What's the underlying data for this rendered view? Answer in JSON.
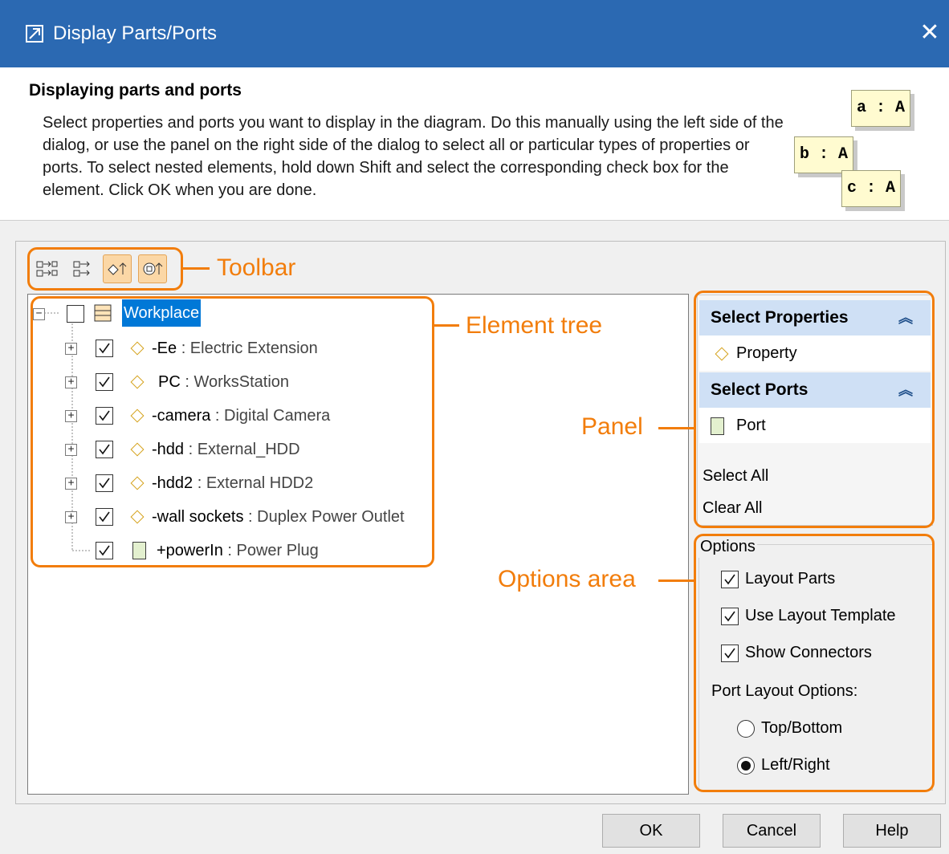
{
  "window": {
    "title": "Display Parts/Ports",
    "close_icon": "close-icon"
  },
  "header": {
    "title": "Displaying parts and ports",
    "description": "Select properties and ports you want to display in the diagram. Do this manually using the left side of the dialog, or use the panel on the right side of the dialog to select all or particular types of properties or ports. To select nested elements, hold down Shift and select the corresponding check box for the element. Click OK when you are done.",
    "classifiers": [
      "a : A",
      "b : A",
      "c : A"
    ]
  },
  "toolbar": {
    "buttons": [
      {
        "icon": "expand-all-icon",
        "active": false
      },
      {
        "icon": "collapse-all-icon",
        "active": false
      },
      {
        "icon": "show-properties-icon",
        "active": true
      },
      {
        "icon": "show-ports-icon",
        "active": true
      }
    ]
  },
  "tree": {
    "root": {
      "label": "Workplace",
      "checked": false,
      "selected": true
    },
    "items": [
      {
        "name": "-Ee",
        "type": ": Electric Extension",
        "checked": true,
        "kind": "property"
      },
      {
        "name": "PC",
        "type": ": WorksStation",
        "checked": true,
        "kind": "property"
      },
      {
        "name": "-camera",
        "type": ": Digital Camera",
        "checked": true,
        "kind": "property"
      },
      {
        "name": "-hdd",
        "type": ": External_HDD",
        "checked": true,
        "kind": "property"
      },
      {
        "name": "-hdd2",
        "type": ": External HDD2",
        "checked": true,
        "kind": "property"
      },
      {
        "name": "-wall sockets",
        "type": ": Duplex Power Outlet",
        "checked": true,
        "kind": "property"
      },
      {
        "name": "+powerIn",
        "type": ": Power Plug",
        "checked": true,
        "kind": "port"
      }
    ]
  },
  "panel": {
    "properties_header": "Select Properties",
    "property_item": "Property",
    "ports_header": "Select Ports",
    "port_item": "Port",
    "select_all": "Select All",
    "clear_all": "Clear All"
  },
  "options": {
    "legend": "Options",
    "layout_parts": "Layout Parts",
    "use_layout_template": "Use Layout Template",
    "show_connectors": "Show Connectors",
    "port_layout_label": "Port Layout Options:",
    "top_bottom": "Top/Bottom",
    "left_right": "Left/Right",
    "selected_port_layout": "Left/Right"
  },
  "buttons": {
    "ok": "OK",
    "cancel": "Cancel",
    "help": "Help"
  },
  "annotations": {
    "toolbar": "Toolbar",
    "element_tree": "Element tree",
    "panel": "Panel",
    "options_area": "Options area"
  },
  "colors": {
    "accent": "#f27d0b",
    "titlebar": "#2b69b2",
    "selection": "#0078d7",
    "panel_header": "#cfe0f5"
  }
}
